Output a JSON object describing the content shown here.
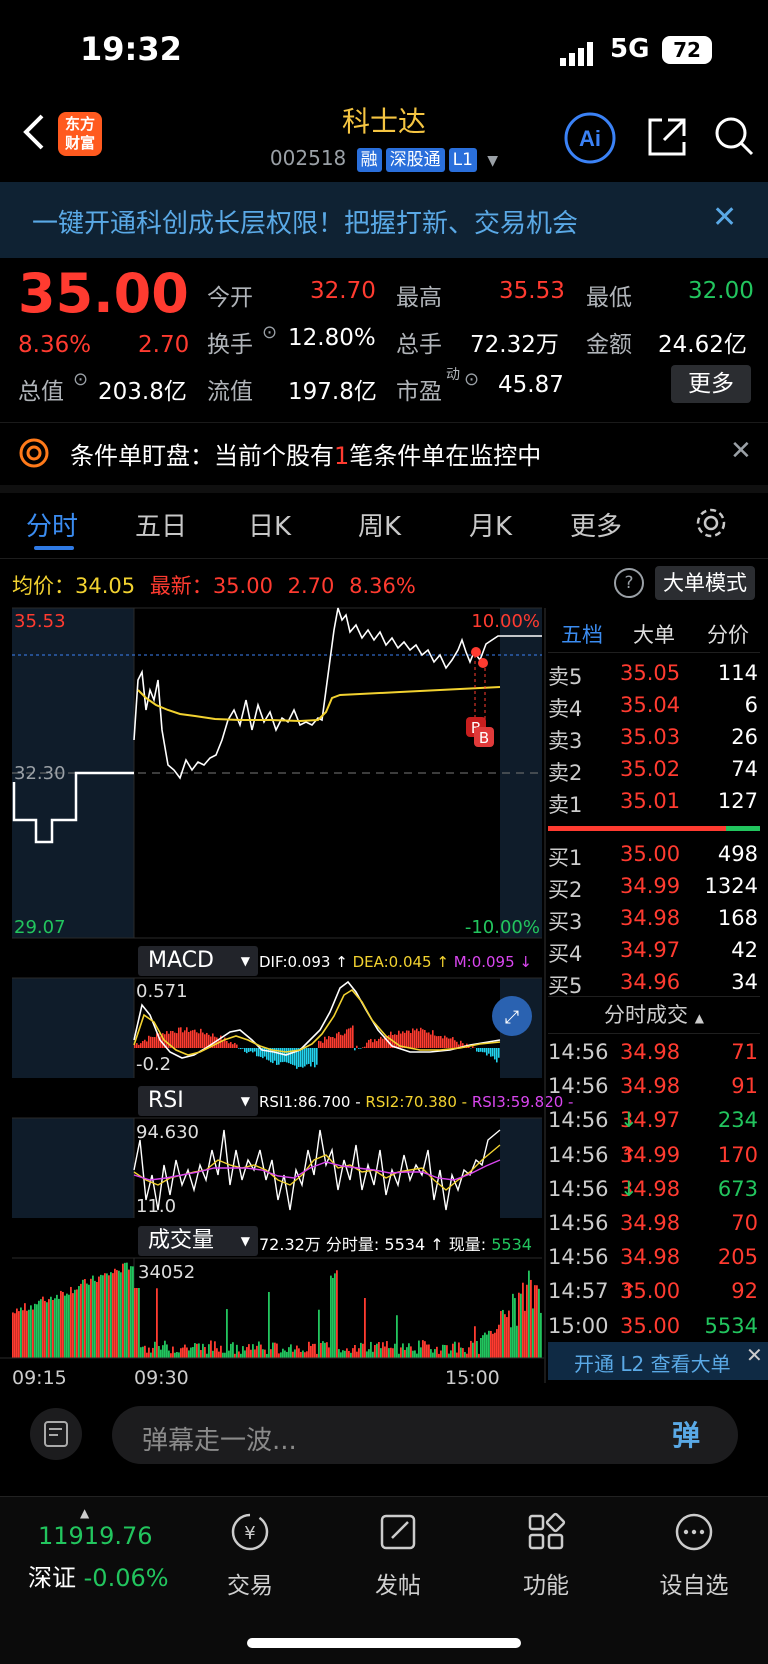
{
  "status_bar": {
    "time": "19:32",
    "network": "5G",
    "battery": "72"
  },
  "header": {
    "logo_line1": "东方",
    "logo_line2": "财富",
    "stock_name": "科士达",
    "stock_code": "002518",
    "tags": [
      "融",
      "深股通",
      "L1"
    ],
    "ai_label": "Ai"
  },
  "banner": {
    "text": "一键开通科创成长层权限！把握打新、交易机会"
  },
  "quote": {
    "price": "35.00",
    "change_pct": "8.36%",
    "change": "2.70",
    "open_label": "今开",
    "open": "32.70",
    "high_label": "最高",
    "high": "35.53",
    "low_label": "最低",
    "low": "32.00",
    "turnover_label": "换手",
    "turnover": "12.80%",
    "volume_label": "总手",
    "volume": "72.32万",
    "amount_label": "金额",
    "amount": "24.62亿",
    "mktcap_label": "总值",
    "mktcap": "203.8亿",
    "float_label": "流值",
    "float": "197.8亿",
    "pe_label": "市盈",
    "pe_sup": "动",
    "pe": "45.87",
    "more": "更多"
  },
  "alert": {
    "prefix": "条件单盯盘：当前个股有",
    "count": "1",
    "suffix": "笔条件单在监控中"
  },
  "tabs": [
    "分时",
    "五日",
    "日K",
    "周K",
    "月K",
    "更多"
  ],
  "info": {
    "avg_label": "均价：",
    "avg": "34.05",
    "last_label": "最新：",
    "last": "35.00",
    "change": "2.70",
    "pct": "8.36%",
    "mode_button": "大单模式"
  },
  "chart": {
    "y_top": "35.53",
    "y_mid": "32.30",
    "y_bottom": "29.07",
    "pct_top": "10.00%",
    "pct_bottom": "-10.00%",
    "x_labels": [
      "09:15",
      "09:30",
      "15:00"
    ],
    "markers": [
      "B",
      "B"
    ],
    "macd": {
      "name": "MACD",
      "dif": "DIF:0.093 ↑",
      "dea": "DEA:0.045 ↑",
      "m": "M:0.095 ↓",
      "top": "0.571",
      "bottom": "-0.2"
    },
    "rsi": {
      "name": "RSI",
      "rsi1": "RSI1:86.700 -",
      "rsi2": "RSI2:70.380 -",
      "rsi3": "RSI3:59.820 -",
      "top": "94.630",
      "bottom": "11.0"
    },
    "vol": {
      "name": "成交量",
      "total": "72.32万",
      "fen_label": "分时量:",
      "fen": "5534 ↑",
      "now_label": "现量:",
      "now": "5534",
      "top": "34052"
    }
  },
  "order_book": {
    "tabs": [
      "五档",
      "大单",
      "分价"
    ],
    "asks": [
      {
        "label": "卖5",
        "price": "35.05",
        "vol": "114"
      },
      {
        "label": "卖4",
        "price": "35.04",
        "vol": "6"
      },
      {
        "label": "卖3",
        "price": "35.03",
        "vol": "26"
      },
      {
        "label": "卖2",
        "price": "35.02",
        "vol": "74"
      },
      {
        "label": "卖1",
        "price": "35.01",
        "vol": "127"
      }
    ],
    "bids": [
      {
        "label": "买1",
        "price": "35.00",
        "vol": "498"
      },
      {
        "label": "买2",
        "price": "34.99",
        "vol": "1324"
      },
      {
        "label": "买3",
        "price": "34.98",
        "vol": "168"
      },
      {
        "label": "买4",
        "price": "34.97",
        "vol": "42"
      },
      {
        "label": "买5",
        "price": "34.96",
        "vol": "34"
      }
    ],
    "trades_title": "分时成交",
    "trades": [
      {
        "time": "14:56",
        "price": "34.98",
        "arrow": "",
        "vol": "71",
        "color": "#ff3b30"
      },
      {
        "time": "14:56",
        "price": "34.98",
        "arrow": "",
        "vol": "91",
        "color": "#ff3b30"
      },
      {
        "time": "14:56",
        "price": "34.97",
        "arrow": "↓",
        "vol": "234",
        "color": "#22c55e"
      },
      {
        "time": "14:56",
        "price": "34.99",
        "arrow": "↑",
        "vol": "170",
        "color": "#ff3b30"
      },
      {
        "time": "14:56",
        "price": "34.98",
        "arrow": "↓",
        "vol": "673",
        "color": "#22c55e"
      },
      {
        "time": "14:56",
        "price": "34.98",
        "arrow": "",
        "vol": "70",
        "color": "#ff3b30"
      },
      {
        "time": "14:56",
        "price": "34.98",
        "arrow": "",
        "vol": "205",
        "color": "#ff3b30"
      },
      {
        "time": "14:57",
        "price": "35.00",
        "arrow": "↑",
        "vol": "92",
        "color": "#ff3b30"
      },
      {
        "time": "15:00",
        "price": "35.00",
        "arrow": "",
        "vol": "5534",
        "color": "#22c55e"
      }
    ],
    "l2_banner": "开通 L2 查看大单"
  },
  "danmu": {
    "placeholder": "弹幕走一波...",
    "button": "弹"
  },
  "tabbar": {
    "index_value": "11919.76",
    "index_name": "深证",
    "index_change": "-0.06%",
    "items": [
      "交易",
      "发帖",
      "功能",
      "设自选"
    ]
  }
}
